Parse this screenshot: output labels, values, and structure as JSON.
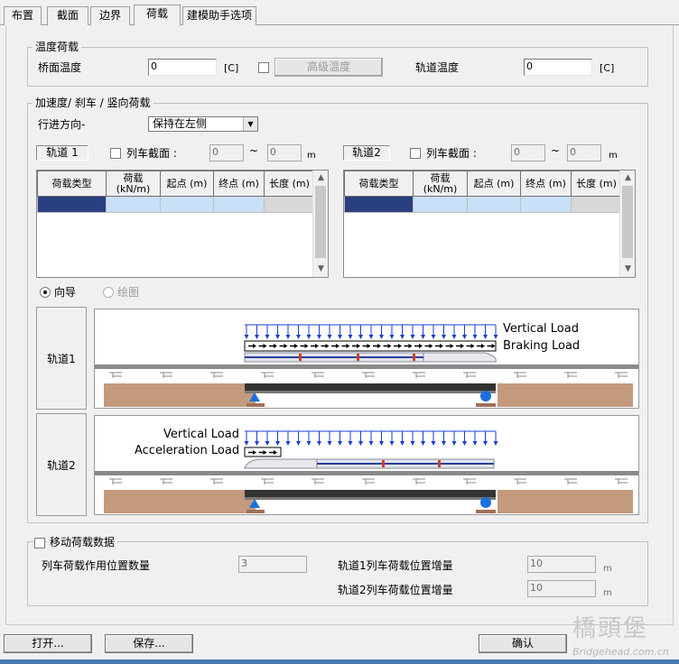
{
  "tabs": [
    {
      "label": "布置"
    },
    {
      "label": "截面"
    },
    {
      "label": "边界"
    },
    {
      "label": "荷载"
    },
    {
      "label": "建模助手选项"
    }
  ],
  "temperature": {
    "group_title": "温度荷载",
    "deck_label": "桥面温度",
    "deck_value": "0",
    "deck_unit": "[C]",
    "advanced_button": "高级温度",
    "track_label": "轨道温度",
    "track_value": "0",
    "track_unit": "[C]"
  },
  "accel": {
    "group_title": "加速度/ 刹车 / 竖向荷载",
    "direction_label": "行进方向-",
    "direction_value": "保持在左侧",
    "track1": {
      "label": "轨道 1",
      "train_label": "列车截面 :",
      "from": "0",
      "tilde": "~",
      "to": "0",
      "unit": "m"
    },
    "track2": {
      "label": "轨道2",
      "train_label": "列车截面 :",
      "from": "0",
      "tilde": "~",
      "to": "0",
      "unit": "m"
    },
    "columns": [
      "荷载类型",
      "荷载\n(kN/m)",
      "起点 (m)",
      "终点 (m)",
      "长度 (m)"
    ],
    "wizard_label": "向导",
    "draw_label": "绘图",
    "row1_label": "轨道1",
    "row2_label": "轨道2",
    "diag1": {
      "vertical": "Vertical Load",
      "braking": "Braking Load"
    },
    "diag2": {
      "vertical": "Vertical Load",
      "accel": "Acceleration Load"
    }
  },
  "moving": {
    "group_title": "移动荷载数据",
    "positions_label": "列车荷载作用位置数量",
    "positions_value": "3",
    "inc1_label": "轨道1列车荷载位置增量",
    "inc1_value": "10",
    "inc1_unit": "m",
    "inc2_label": "轨道2列车荷载位置增量",
    "inc2_value": "10",
    "inc2_unit": "m"
  },
  "buttons": {
    "open": "打开...",
    "save": "保存...",
    "ok": "确认"
  },
  "watermark": {
    "cn": "橋頭堡",
    "en": "Bridgehead.com.cn"
  },
  "colors": {
    "load_arrow": "#1a3fd0",
    "ground": "#c49a7c",
    "support": "#1a6fe0",
    "grid_sel": "#c8e0f8",
    "grid_dark": "#2a3f7f"
  }
}
